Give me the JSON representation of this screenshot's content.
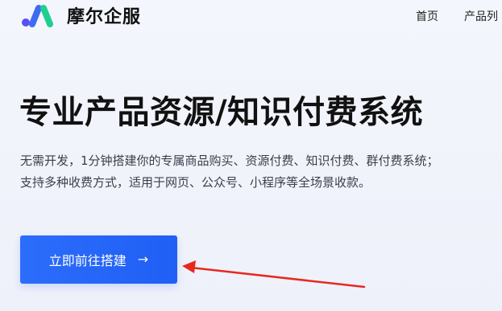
{
  "brand": {
    "name": "摩尔企服",
    "logo_icon": "mooer-logo-icon",
    "colors": {
      "dot": "#5b4ef5",
      "bar_blue": "#3d6bf5",
      "bar_green": "#1fcf8e"
    }
  },
  "nav": {
    "items": [
      {
        "label": "首页"
      },
      {
        "label": "产品列"
      }
    ]
  },
  "hero": {
    "title": "专业产品资源/知识付费系统",
    "description_lines": [
      "无需开发，1分钟搭建你的专属商品购买、资源付费、知识付费、群付费系统；",
      "支持多种收费方式，适用于网页、公众号、小程序等全场景收款。"
    ]
  },
  "cta": {
    "label": "立即前往搭建",
    "icon": "arrow-right-icon",
    "color": "#2266f8"
  },
  "annotation": {
    "icon": "red-pointer-arrow",
    "color": "#e8281e"
  }
}
